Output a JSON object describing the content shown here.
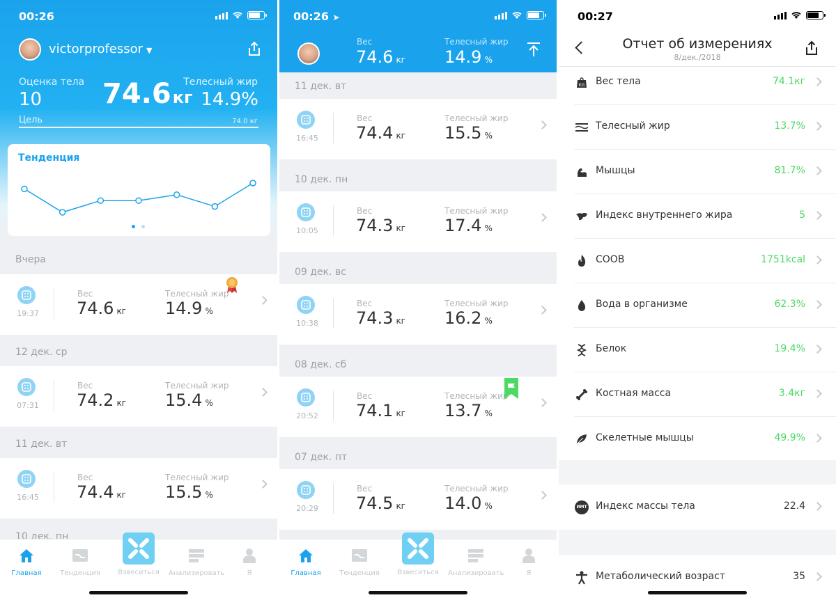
{
  "status": {
    "left_time": "00:26",
    "middle_time": "00:26",
    "right_time": "00:27"
  },
  "home": {
    "username": "victorprofessor",
    "body_score_label": "Оценка тела",
    "body_score": "10",
    "weight": "74.6",
    "weight_unit": "кг",
    "body_fat_label": "Телесный жир",
    "body_fat": "14.9%",
    "goal_label": "Цель",
    "goal_value": "74.0 кг",
    "trend_title": "Тенденция",
    "trend_points": [
      74.6,
      74.2,
      74.4,
      74.4,
      74.5,
      74.3,
      74.7
    ],
    "weight_label": "Вес",
    "fat_label": "Телесный жир",
    "days": [
      {
        "day": "Вчера",
        "time": "19:37",
        "weight": "74.6",
        "fat": "14.9",
        "badge": "medal"
      },
      {
        "day": "12 дек. ср",
        "time": "07:31",
        "weight": "74.2",
        "fat": "15.4"
      },
      {
        "day": "11 дек. вт",
        "time": "16:45",
        "weight": "74.4",
        "fat": "15.5"
      },
      {
        "day": "10 дек. пн"
      }
    ],
    "unit_kg": "кг",
    "unit_pct": "%"
  },
  "tabs": [
    {
      "label": "Главная",
      "icon": "home-icon"
    },
    {
      "label": "Тенденция",
      "icon": "trend-icon"
    },
    {
      "label": "Взвеситься",
      "icon": "scale-icon"
    },
    {
      "label": "Анализировать",
      "icon": "analyze-icon"
    },
    {
      "label": "Я",
      "icon": "profile-icon"
    }
  ],
  "history": {
    "header_weight_label": "Вес",
    "header_weight": "74.6",
    "header_fat_label": "Телесный жир",
    "header_fat": "14.9",
    "weight_label": "Вес",
    "fat_label": "Телесный жир",
    "unit_kg": "кг",
    "unit_pct": "%",
    "top_day": "11 дек. вт",
    "days": [
      {
        "time": "16:45",
        "weight": "74.4",
        "fat": "15.5",
        "next_day": "10 дек. пн"
      },
      {
        "time": "10:05",
        "weight": "74.3",
        "fat": "17.4",
        "next_day": "09 дек. вс"
      },
      {
        "time": "10:38",
        "weight": "74.3",
        "fat": "16.2",
        "next_day": "08 дек. сб"
      },
      {
        "time": "20:52",
        "weight": "74.1",
        "fat": "13.7",
        "next_day": "07 дек. пт",
        "badge": "flag"
      },
      {
        "time": "20:29",
        "weight": "74.5",
        "fat": "14.0"
      }
    ]
  },
  "report": {
    "title": "Отчет об измерениях",
    "date": "8/дек./2018",
    "metrics": [
      {
        "name": "Вес тела",
        "value": "74.1кг",
        "icon": "weight-icon"
      },
      {
        "name": "Телесный жир",
        "value": "13.7%",
        "icon": "body-fat-icon"
      },
      {
        "name": "Мышцы",
        "value": "81.7%",
        "icon": "muscle-icon"
      },
      {
        "name": "Индекс внутреннего жира",
        "value": "5",
        "icon": "visceral-fat-icon"
      },
      {
        "name": "СООВ",
        "value": "1751kcal",
        "icon": "flame-icon"
      },
      {
        "name": "Вода в организме",
        "value": "62.3%",
        "icon": "water-drop-icon"
      },
      {
        "name": "Белок",
        "value": "19.4%",
        "icon": "protein-icon"
      },
      {
        "name": "Костная масса",
        "value": "3.4кг",
        "icon": "bone-icon"
      },
      {
        "name": "Скелетные мышцы",
        "value": "49.9%",
        "icon": "leaf-icon"
      }
    ],
    "bmi": {
      "name": "Индекс массы тела",
      "value": "22.4",
      "icon_text": "ИМТ"
    },
    "metabolic_age": {
      "name": "Метаболический возраст",
      "value": "35"
    }
  },
  "colors": {
    "primary": "#1aa3ec",
    "positive": "#4cd964"
  }
}
